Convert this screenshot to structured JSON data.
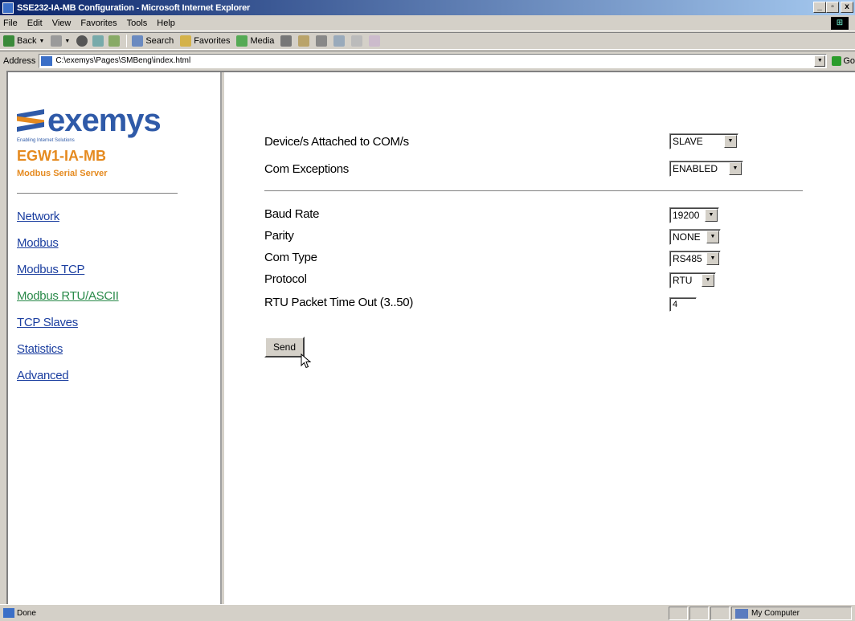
{
  "window": {
    "title": "SSE232-IA-MB Configuration - Microsoft Internet Explorer",
    "buttons": [
      "_",
      "▫",
      "x"
    ]
  },
  "menu": [
    "File",
    "Edit",
    "View",
    "Favorites",
    "Tools",
    "Help"
  ],
  "toolbar": {
    "back": "Back",
    "search": "Search",
    "favorites": "Favorites",
    "media": "Media"
  },
  "address": {
    "label": "Address",
    "url": "C:\\exemys\\Pages\\SMBeng\\index.html",
    "go": "Go"
  },
  "sidebar": {
    "brand": "exemys",
    "tagline": "Enabling Internet Solutions",
    "product": "EGW1-IA-MB",
    "product_sub": "Modbus Serial Server",
    "nav": [
      "Network",
      "Modbus",
      "Modbus TCP",
      "Modbus RTU/ASCII",
      "TCP Slaves",
      "Statistics",
      "Advanced"
    ]
  },
  "form": {
    "devices_label": "Device/s Attached to COM/s",
    "devices_value": "SLAVE",
    "exceptions_label": "Com Exceptions",
    "exceptions_value": "ENABLED",
    "baud_label": "Baud Rate",
    "baud_value": "19200",
    "parity_label": "Parity",
    "parity_value": "NONE",
    "comtype_label": "Com Type",
    "comtype_value": "RS485",
    "protocol_label": "Protocol",
    "protocol_value": "RTU",
    "timeout_label": "RTU Packet Time Out (3..50)",
    "timeout_value": "4",
    "send": "Send"
  },
  "status": {
    "text": "Done",
    "zone": "My Computer"
  },
  "colors": {
    "brand_blue": "#2f5aa8",
    "brand_orange": "#e58a1f",
    "link": "#1c3fa0",
    "visited_link": "#2a8a4a"
  }
}
